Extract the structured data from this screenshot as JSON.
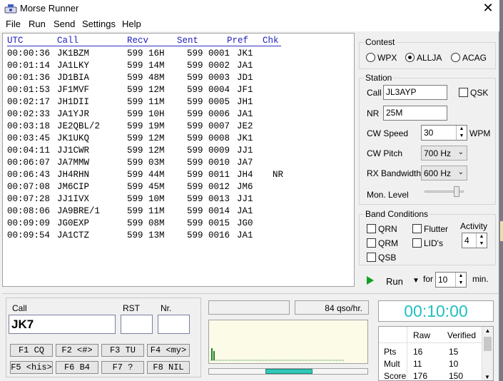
{
  "window": {
    "title": "Morse Runner",
    "close_glyph": "✕"
  },
  "menu": [
    "File",
    "Run",
    "Send",
    "Settings",
    "Help"
  ],
  "log": {
    "headers": {
      "utc": "UTC",
      "call": "Call",
      "recv": "Recv",
      "sent": "Sent",
      "pref": "Pref",
      "chk": "Chk"
    },
    "rows": [
      {
        "utc": "00:00:36",
        "call": "JK1BZM",
        "recv": "599 16H",
        "sent": "599 0001",
        "pref": "JK1",
        "chk": ""
      },
      {
        "utc": "00:01:14",
        "call": "JA1LKY",
        "recv": "599 14M",
        "sent": "599 0002",
        "pref": "JA1",
        "chk": ""
      },
      {
        "utc": "00:01:36",
        "call": "JD1BIA",
        "recv": "599 48M",
        "sent": "599 0003",
        "pref": "JD1",
        "chk": ""
      },
      {
        "utc": "00:01:53",
        "call": "JF1MVF",
        "recv": "599 12M",
        "sent": "599 0004",
        "pref": "JF1",
        "chk": ""
      },
      {
        "utc": "00:02:17",
        "call": "JH1DII",
        "recv": "599 11M",
        "sent": "599 0005",
        "pref": "JH1",
        "chk": ""
      },
      {
        "utc": "00:02:33",
        "call": "JA1YJR",
        "recv": "599 10H",
        "sent": "599 0006",
        "pref": "JA1",
        "chk": ""
      },
      {
        "utc": "00:03:18",
        "call": "JE2QBL/2",
        "recv": "599 19M",
        "sent": "599 0007",
        "pref": "JE2",
        "chk": ""
      },
      {
        "utc": "00:03:45",
        "call": "JK1UKQ",
        "recv": "599 12M",
        "sent": "599 0008",
        "pref": "JK1",
        "chk": ""
      },
      {
        "utc": "00:04:11",
        "call": "JJ1CWR",
        "recv": "599 12M",
        "sent": "599 0009",
        "pref": "JJ1",
        "chk": ""
      },
      {
        "utc": "00:06:07",
        "call": "JA7MMW",
        "recv": "599 03M",
        "sent": "599 0010",
        "pref": "JA7",
        "chk": ""
      },
      {
        "utc": "00:06:43",
        "call": "JH4RHN",
        "recv": "599 44M",
        "sent": "599 0011",
        "pref": "JH4",
        "chk": "NR"
      },
      {
        "utc": "00:07:08",
        "call": "JM6CIP",
        "recv": "599 45M",
        "sent": "599 0012",
        "pref": "JM6",
        "chk": ""
      },
      {
        "utc": "00:07:28",
        "call": "JJ1IVX",
        "recv": "599 10M",
        "sent": "599 0013",
        "pref": "JJ1",
        "chk": ""
      },
      {
        "utc": "00:08:06",
        "call": "JA9BRE/1",
        "recv": "599 11M",
        "sent": "599 0014",
        "pref": "JA1",
        "chk": ""
      },
      {
        "utc": "00:09:09",
        "call": "JG0EXP",
        "recv": "599 08M",
        "sent": "599 0015",
        "pref": "JG0",
        "chk": ""
      },
      {
        "utc": "00:09:54",
        "call": "JA1CTZ",
        "recv": "599 13M",
        "sent": "599 0016",
        "pref": "JA1",
        "chk": ""
      }
    ]
  },
  "contest": {
    "title": "Contest",
    "options": [
      "WPX",
      "ALLJA",
      "ACAG"
    ],
    "selected": "ALLJA"
  },
  "station": {
    "title": "Station",
    "call_label": "Call",
    "call_value": "JL3AYP",
    "qsk_label": "QSK",
    "nr_label": "NR",
    "nr_value": "25M",
    "cw_speed_label": "CW Speed",
    "cw_speed_value": "30",
    "wpm_label": "WPM",
    "cw_pitch_label": "CW Pitch",
    "cw_pitch_value": "700 Hz",
    "rx_bw_label": "RX Bandwidth",
    "rx_bw_value": "600 Hz",
    "mon_level_label": "Mon. Level"
  },
  "band": {
    "title": "Band Conditions",
    "qrn": "QRN",
    "qrm": "QRM",
    "qsb": "QSB",
    "flutter": "Flutter",
    "lids": "LID's",
    "activity_label": "Activity",
    "activity_value": "4"
  },
  "run": {
    "run_label": "Run",
    "for_label": "for",
    "minutes": "10",
    "min_label": "min."
  },
  "entry": {
    "call_label": "Call",
    "rst_label": "RST",
    "nr_label": "Nr.",
    "call_value": "JK7",
    "rst_value": "",
    "nr_value": ""
  },
  "fkeys": [
    "F1 CQ",
    "F2 <#>",
    "F3 TU",
    "F4 <my>",
    "F5 <his>",
    "F6 B4",
    "F7 ?",
    "F8 NIL"
  ],
  "status": {
    "rate": "84 qso/hr."
  },
  "clock": "00:10:00",
  "score": {
    "headers": [
      "Raw",
      "Verified"
    ],
    "rows": [
      {
        "label": "Pts",
        "raw": "16",
        "verified": "15"
      },
      {
        "label": "Mult",
        "raw": "11",
        "verified": "10"
      },
      {
        "label": "Score",
        "raw": "176",
        "verified": "150"
      }
    ]
  }
}
